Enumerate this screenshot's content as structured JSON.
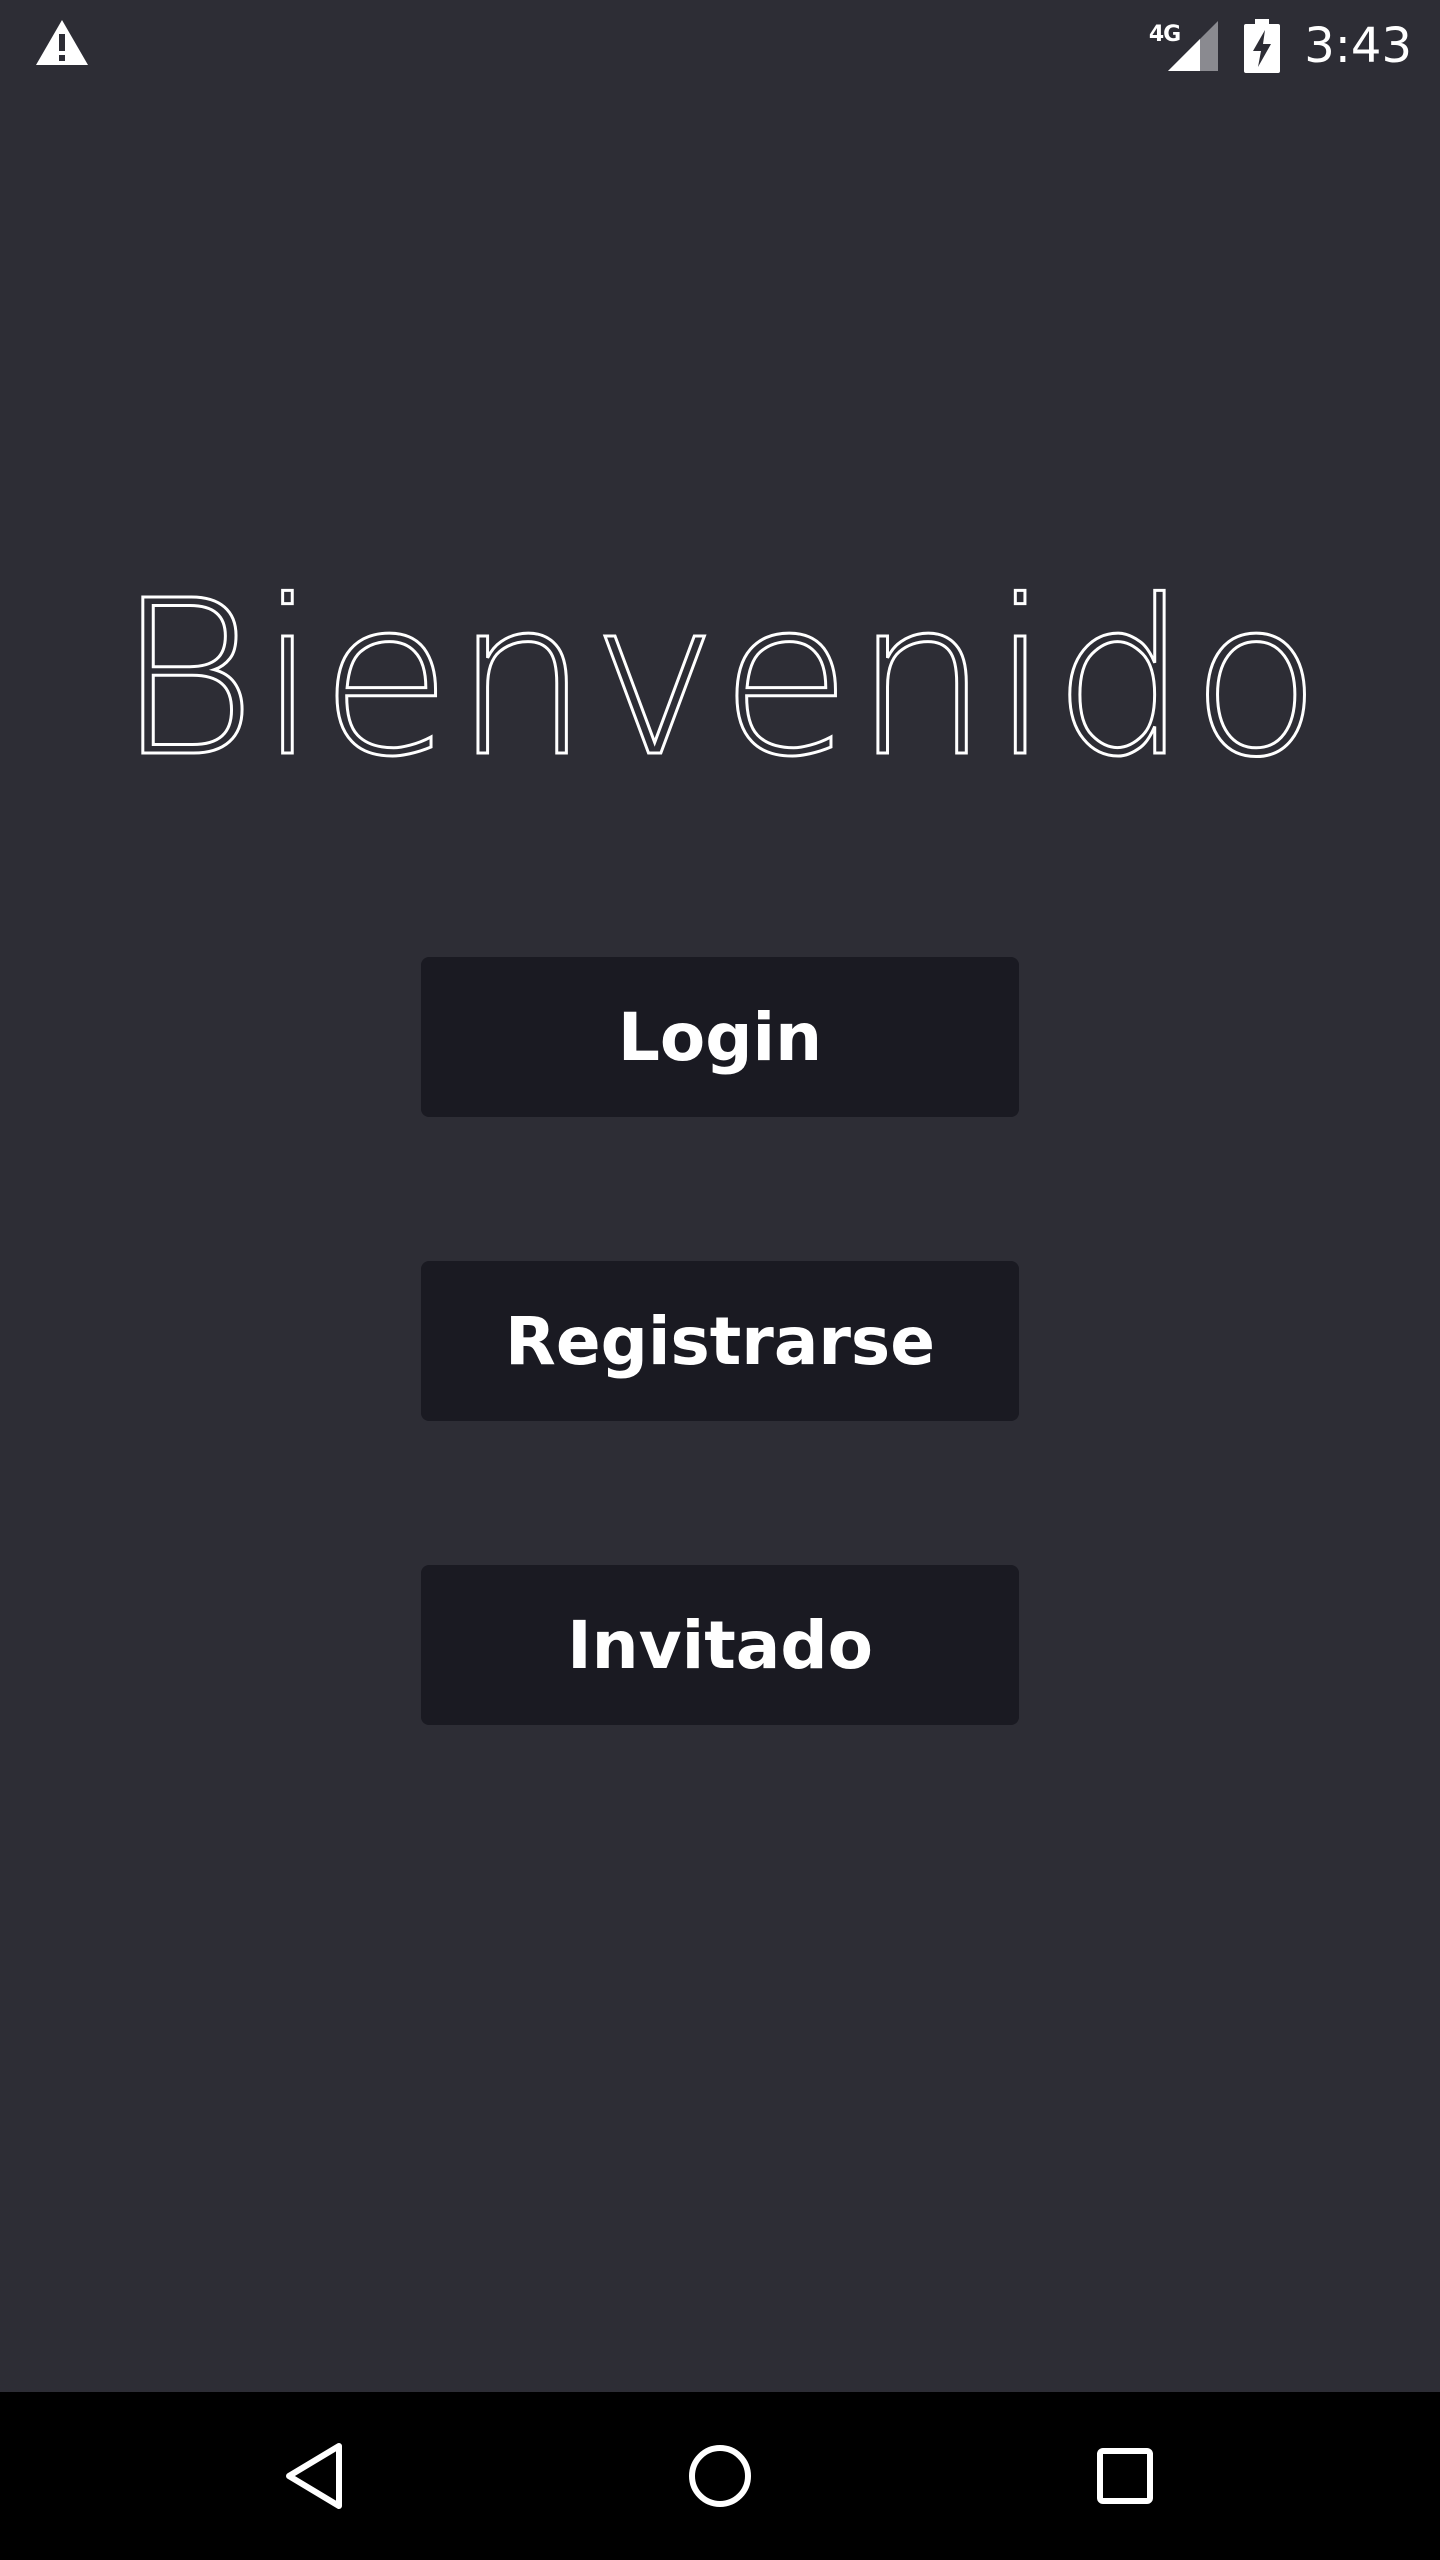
{
  "status_bar": {
    "network_type": "4G",
    "time": "3:43",
    "icons": [
      "warning-icon",
      "cell-signal-icon",
      "battery-charging-icon"
    ]
  },
  "main": {
    "title": "Bienvenido",
    "buttons": {
      "login": "Login",
      "register": "Registrarse",
      "guest": "Invitado"
    }
  },
  "nav_bar": {
    "icons": [
      "back-icon",
      "home-icon",
      "recents-icon"
    ]
  },
  "colors": {
    "background": "#2d2d35",
    "button_background": "#1a1a22",
    "text": "#ffffff",
    "nav_bar_background": "#000000"
  }
}
